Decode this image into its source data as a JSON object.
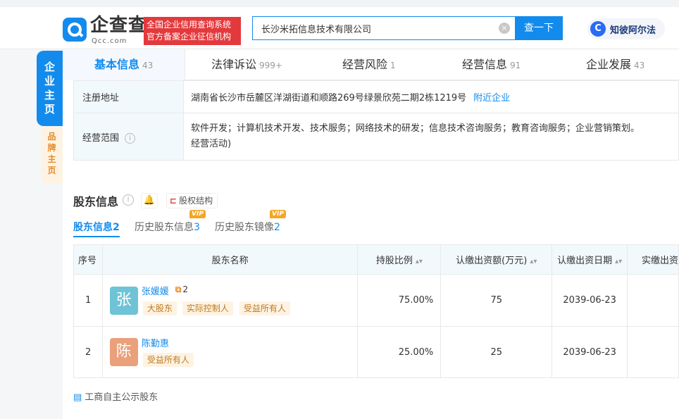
{
  "header": {
    "logo_name": "企查查",
    "logo_sub": "Qcc.com",
    "slogan_line1": "全国企业信用查询系统",
    "slogan_line2": "官方备案企业征信机构",
    "search_value": "长沙米拓信息技术有限公司",
    "search_button": "查一下",
    "partner_icon": "C",
    "partner_label": "知彼阿尔法"
  },
  "side_tabs": {
    "main": [
      "企",
      "业",
      "主",
      "页"
    ],
    "brand": [
      "品",
      "牌",
      "主",
      "页"
    ]
  },
  "nav": [
    {
      "label": "基本信息",
      "count": "43"
    },
    {
      "label": "法律诉讼",
      "count": "999+"
    },
    {
      "label": "经营风险",
      "count": "1"
    },
    {
      "label": "经营信息",
      "count": "91"
    },
    {
      "label": "企业发展",
      "count": "43"
    }
  ],
  "info": {
    "address_label": "注册地址",
    "address_value": "湖南省长沙市岳麓区洋湖街道和顺路269号绿景欣苑二期2栋1219号",
    "address_link": "附近企业",
    "scope_label": "经营范围",
    "scope_line1": "软件开发；计算机技术开发、技术服务；网络技术的研发；信息技术咨询服务；教育咨询服务；企业营销策划。",
    "scope_line2": "经营活动)"
  },
  "shareholders": {
    "title": "股东信息",
    "structure_button": "股权结构",
    "subtabs": [
      {
        "label": "股东信息",
        "count": "2"
      },
      {
        "label": "历史股东信息",
        "count": "3"
      },
      {
        "label": "历史股东镜像",
        "count": "2"
      }
    ],
    "vip_label": "VIP",
    "columns": [
      "序号",
      "股东名称",
      "持股比例",
      "认缴出资额(万元)",
      "认缴出资日期",
      "实缴出资"
    ],
    "rows": [
      {
        "index": "1",
        "avatar": "张",
        "name": "张媛媛",
        "relation_count": "2",
        "tags": [
          "大股东",
          "实际控制人",
          "受益所有人"
        ],
        "ratio": "75.00%",
        "amount": "75",
        "date": "2039-06-23"
      },
      {
        "index": "2",
        "avatar": "陈",
        "name": "陈勤惠",
        "tags": [
          "受益所有人"
        ],
        "ratio": "25.00%",
        "amount": "25",
        "date": "2039-06-23"
      }
    ],
    "footer_link": "工商自主公示股东"
  },
  "colors": {
    "brand_blue": "#128bed",
    "slogan_red": "#e4393c",
    "avatar_teal": "#6ec3d6",
    "avatar_orange": "#e9a07b",
    "tag_bg": "#fef3e3"
  }
}
